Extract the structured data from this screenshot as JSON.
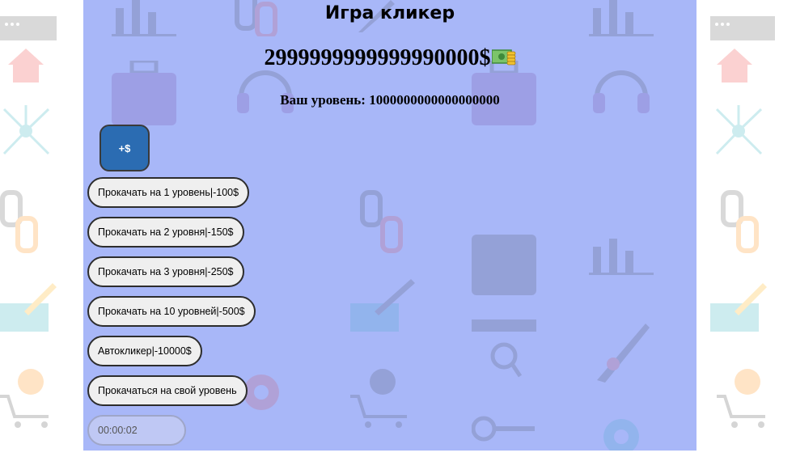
{
  "game": {
    "title": "Игра кликер",
    "balance": "2999999999999990000$",
    "level_text": "Ваш уровень: 1000000000000000000",
    "click_label": "+$"
  },
  "upgrades": [
    {
      "label": "Прокачать на 1 уровень|-100$"
    },
    {
      "label": "Прокачать на 2 уровня|-150$"
    },
    {
      "label": "Прокачать на 3 уровня|-250$"
    },
    {
      "label": "Прокачать на 10 уровней|-500$"
    },
    {
      "label": "Автокликер|-10000$"
    },
    {
      "label": "Прокачаться на свой уровень"
    }
  ],
  "timer": {
    "value": "00:00:02"
  },
  "colors": {
    "panel_bg": "#a8b7f8",
    "click_button": "#2b6cb2",
    "pill_bg": "#efefef"
  },
  "icons": [
    "cash-icon",
    "home-icon",
    "network-icon",
    "link-icon",
    "pencil-icon",
    "cart-gear-icon",
    "chart-icon",
    "headset-icon",
    "briefcase-icon",
    "rocket-icon",
    "search-icon",
    "key-icon"
  ]
}
